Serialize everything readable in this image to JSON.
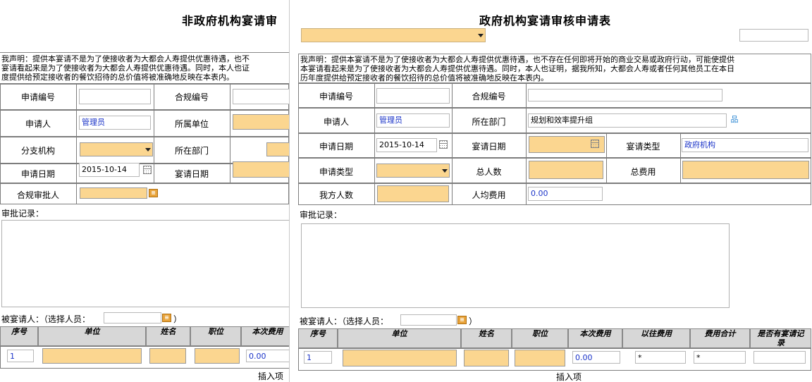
{
  "left": {
    "title": "非政府机构宴请审",
    "declaration": [
      "我声明：提供本宴请不是为了使接收者为大都会人寿提供优惠待遇，也不",
      "宴请看起来是为了使接收者为大都会人寿提供优惠待遇。同时，本人也证",
      "度提供给预定接收者的餐饮招待的总价值将被准确地反映在本表内。"
    ],
    "labels": {
      "req_no": "申请编号",
      "compliance_no": "合规编号",
      "applicant": "申请人",
      "unit": "所属单位",
      "branch": "分支机构",
      "dept": "所在部门",
      "apply_date": "申请日期",
      "banquet_date": "宴请日期",
      "approver": "合规审批人",
      "approval_log": "审批记录：",
      "invitee": "被宴请人：（选择人员：",
      "invitee_close": "）",
      "insert": "插入项"
    },
    "values": {
      "applicant": "管理员",
      "apply_date": "2015-10-14",
      "row1_no": "1",
      "row1_cost": "0.00"
    },
    "columns": [
      "序号",
      "单位",
      "姓名",
      "职位",
      "本次费用"
    ]
  },
  "right": {
    "title": "政府机构宴请审核申请表",
    "declaration": [
      "我声明：提供本宴请不是为了使接收者为大都会人寿提供优惠待遇，也不存在任何即将开始的商业交易或政府行动，可能使提供",
      "本宴请看起来是为了使接收者为大都会人寿提供优惠待遇。同时，本人也证明，据我所知，大都会人寿或者任何其他员工在本日",
      "历年度提供给预定接收者的餐饮招待的总价值将被准确地反映在本表内。"
    ],
    "labels": {
      "req_no": "申请编号",
      "compliance_no": "合规编号",
      "applicant": "申请人",
      "dept": "所在部门",
      "apply_date": "申请日期",
      "banquet_date": "宴请日期",
      "banquet_type": "宴请类型",
      "apply_type": "申请类型",
      "total_people": "总人数",
      "total_cost": "总费用",
      "our_people": "我方人数",
      "per_cost": "人均费用",
      "approval_log": "审批记录：",
      "invitee": "被宴请人：（选择人员：",
      "invitee_close": "）",
      "insert": "插入项"
    },
    "values": {
      "applicant": "管理员",
      "dept": "规划和效率提升组",
      "apply_date": "2015-10-14",
      "banquet_type": "政府机构",
      "per_cost": "0.00",
      "row1_no": "1",
      "row1_cost": "0.00",
      "row1_prev": "*",
      "row1_sum": "*"
    },
    "columns": [
      "序号",
      "单位",
      "姓名",
      "职位",
      "本次费用",
      "以往费用",
      "费用合计",
      "是否有宴请记录"
    ]
  },
  "colors": {
    "required_field": "#fbd690",
    "link_blue": "#1a33c8",
    "header_bg": "#d7d7d7"
  }
}
